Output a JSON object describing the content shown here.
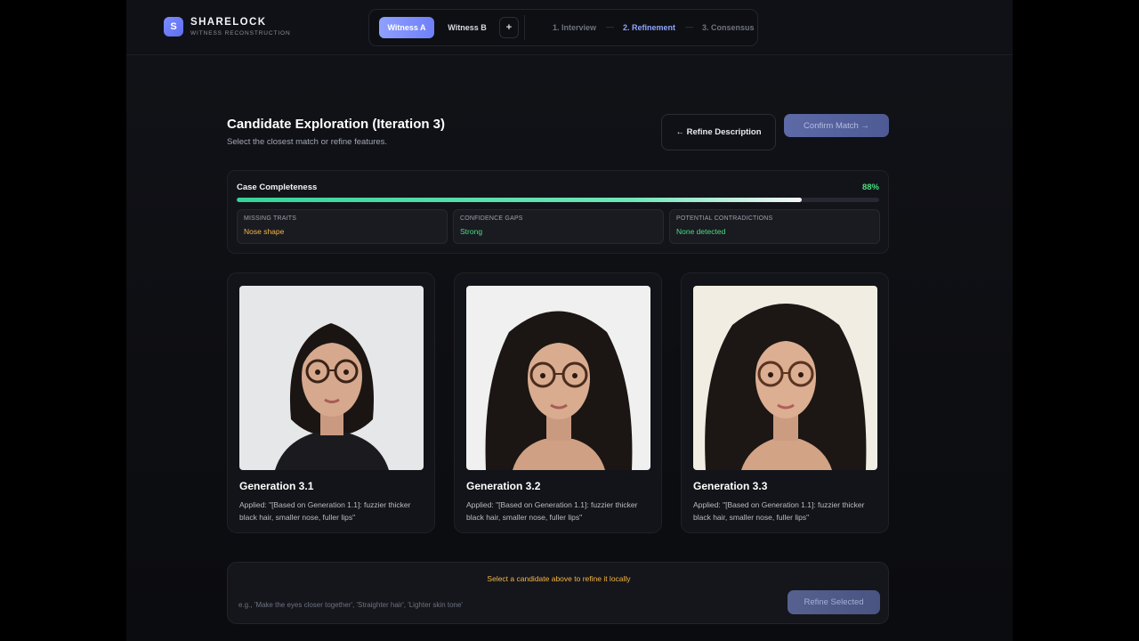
{
  "brand": {
    "logo_letter": "S",
    "name": "SHARELOCK",
    "tagline": "WITNESS RECONSTRUCTION"
  },
  "witness_tabs": [
    {
      "label": "Witness A",
      "active": true
    },
    {
      "label": "Witness B",
      "active": false
    }
  ],
  "add_witness_label": "+",
  "steps": [
    {
      "label": "1. Interview",
      "active": false
    },
    {
      "label": "2. Refinement",
      "active": true
    },
    {
      "label": "3. Consensus",
      "active": false
    }
  ],
  "step_separator": "—",
  "page": {
    "title": "Candidate Exploration (Iteration 3)",
    "subtitle": "Select the closest match or refine features."
  },
  "actions": {
    "refine_description": "← Refine Description",
    "confirm_match": "Confirm Match →"
  },
  "completeness": {
    "label": "Case Completeness",
    "percent_text": "88%",
    "fraction": 0.88,
    "metrics": [
      {
        "label": "MISSING TRAITS",
        "value": "Nose shape",
        "color": "#f5b544"
      },
      {
        "label": "CONFIDENCE GAPS",
        "value": "Strong",
        "color": "#4ade80"
      },
      {
        "label": "POTENTIAL CONTRADICTIONS",
        "value": "None detected",
        "color": "#4ade80"
      }
    ]
  },
  "candidates": [
    {
      "title": "Generation 3.1",
      "description": "Applied: \"[Based on Generation 1.1]: fuzzier thicker black hair, smaller nose, fuller lips\"",
      "background": "#e6e7e9"
    },
    {
      "title": "Generation 3.2",
      "description": "Applied: \"[Based on Generation 1.1]: fuzzier thicker black hair, smaller nose, fuller lips\"",
      "background": "#f0f0f0"
    },
    {
      "title": "Generation 3.3",
      "description": "Applied: \"[Based on Generation 1.1]: fuzzier thicker black hair, smaller nose, fuller lips\"",
      "background": "#f1ede2"
    }
  ],
  "refine_panel": {
    "hint": "Select a candidate above to refine it locally",
    "placeholder": "e.g., 'Make the eyes closer together', 'Straighter hair', 'Lighter skin tone'",
    "button": "Refine Selected"
  },
  "colors": {
    "accent": "#7c8cff",
    "success": "#4ade80",
    "warning": "#f5b544",
    "background": "#0d0e12"
  }
}
